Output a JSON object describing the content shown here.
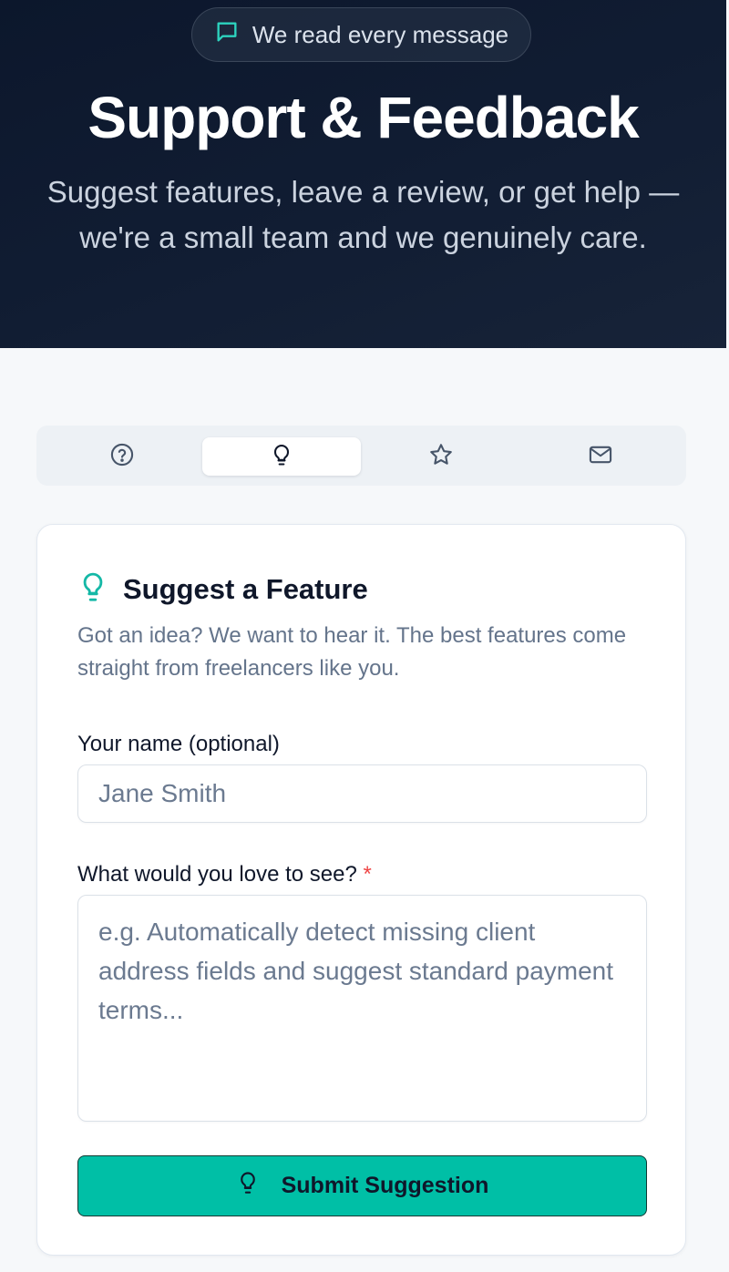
{
  "hero": {
    "badge_text": "We read every message",
    "badge_icon": "message-square-icon",
    "title": "Support & Feedback",
    "subtitle": "Suggest features, leave a review, or get help — we're a small team and we genuinely care."
  },
  "tabs": [
    {
      "icon": "help-circle-icon",
      "active": false
    },
    {
      "icon": "lightbulb-icon",
      "active": true
    },
    {
      "icon": "star-icon",
      "active": false
    },
    {
      "icon": "mail-icon",
      "active": false
    }
  ],
  "form": {
    "icon": "lightbulb-icon",
    "title": "Suggest a Feature",
    "description": "Got an idea? We want to hear it. The best features come straight from freelancers like you.",
    "name_label": "Your name (optional)",
    "name_value": "",
    "name_placeholder": "Jane Smith",
    "idea_label": "What would you love to see?",
    "required_marker": "*",
    "idea_value": "",
    "idea_placeholder": "e.g. Automatically detect missing client address fields and suggest standard payment terms...",
    "submit_label": "Submit Suggestion",
    "submit_icon": "lightbulb-icon"
  },
  "colors": {
    "accent": "#00bfa6",
    "hero_bg": "#0c172c",
    "required": "#ef4444",
    "muted_text": "#64748b"
  }
}
